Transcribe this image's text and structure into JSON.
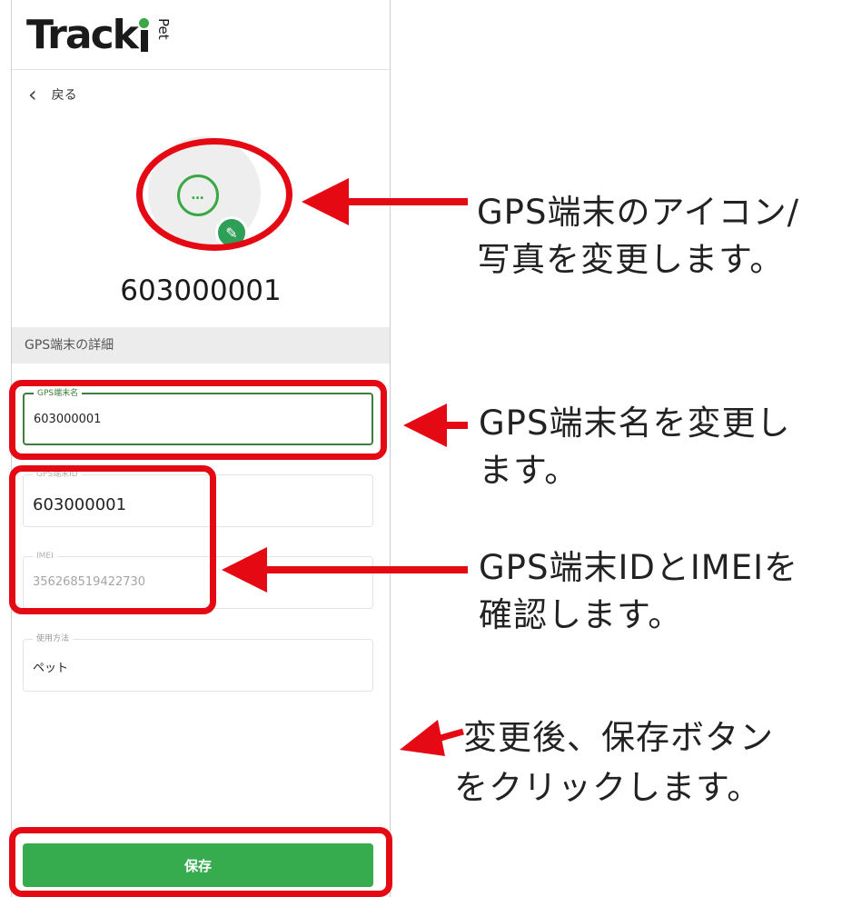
{
  "app": {
    "logo_text": "Track",
    "logo_sub": "Pet",
    "back_label": "戻る"
  },
  "device": {
    "icon_text": "…",
    "id_display": "603000001"
  },
  "section": {
    "title": "GPS端末の詳細"
  },
  "form": {
    "name": {
      "label": "GPS端末名",
      "value": "603000001"
    },
    "device_id": {
      "label": "GPS端末ID",
      "value": "603000001"
    },
    "imei": {
      "label": "IMEI",
      "value": "356268519422730"
    },
    "usage": {
      "label": "使用方法",
      "value": "ペット"
    }
  },
  "buttons": {
    "save_label": "保存"
  },
  "annotations": {
    "icon_note_1": "GPS端末のアイコン/",
    "icon_note_2": "写真を変更します。",
    "name_note_1": "GPS端末名を変更し",
    "name_note_2": "ます。",
    "id_note_1": "GPS端末IDとIMEIを",
    "id_note_2": "確認します。",
    "save_note_1": "変更後、保存ボタン",
    "save_note_2": "をクリックします。"
  },
  "colors": {
    "accent_green": "#36ac4f",
    "highlight_red": "#e50914"
  }
}
